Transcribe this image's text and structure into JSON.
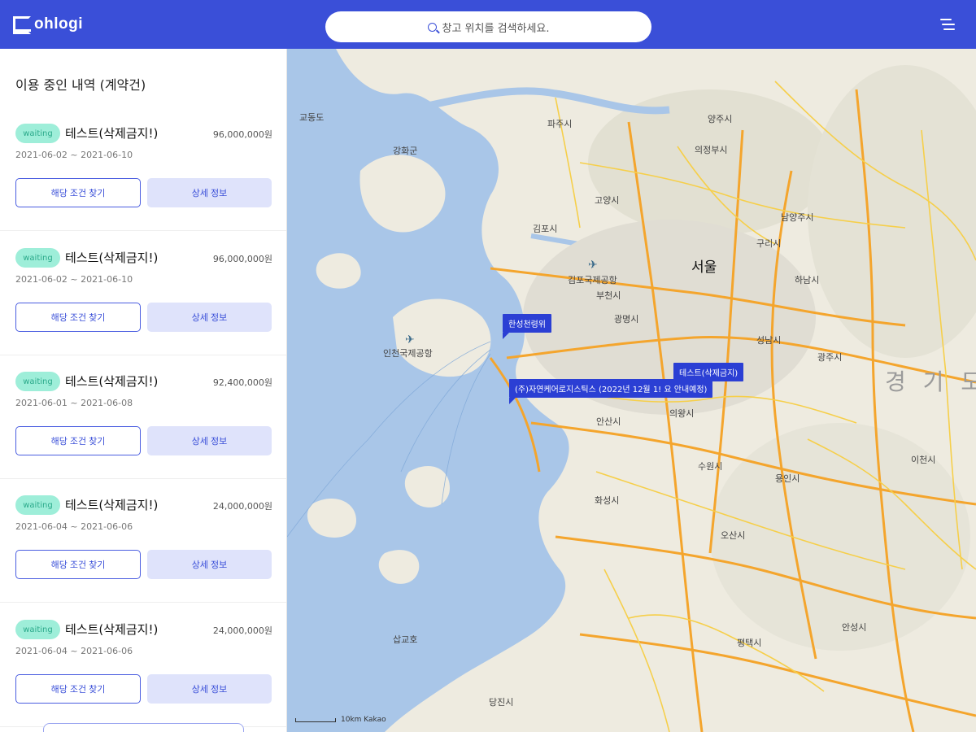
{
  "header": {
    "logo_text": "ohlogi",
    "search_placeholder": "창고 위치를 검색하세요."
  },
  "sidebar": {
    "title": "이용 중인 내역 (계약건)",
    "cards": [
      {
        "status": "waiting",
        "title": "테스트(삭제금지!)",
        "price": "96,000,000원",
        "dates": "2021-06-02 ~ 2021-06-10",
        "btn_find": "해당 조건 찾기",
        "btn_detail": "상세 정보"
      },
      {
        "status": "waiting",
        "title": "테스트(삭제금지!)",
        "price": "96,000,000원",
        "dates": "2021-06-02 ~ 2021-06-10",
        "btn_find": "해당 조건 찾기",
        "btn_detail": "상세 정보"
      },
      {
        "status": "waiting",
        "title": "테스트(삭제금지!)",
        "price": "92,400,000원",
        "dates": "2021-06-01 ~ 2021-06-08",
        "btn_find": "해당 조건 찾기",
        "btn_detail": "상세 정보"
      },
      {
        "status": "waiting",
        "title": "테스트(삭제금지!)",
        "price": "24,000,000원",
        "dates": "2021-06-04 ~ 2021-06-06",
        "btn_find": "해당 조건 찾기",
        "btn_detail": "상세 정보"
      },
      {
        "status": "waiting",
        "title": "테스트(삭제금지!)",
        "price": "24,000,000원",
        "dates": "2021-06-04 ~ 2021-06-06",
        "btn_find": "해당 조건 찾기",
        "btn_detail": "상세 정보"
      }
    ]
  },
  "map": {
    "markers": [
      {
        "label": "한성천령위"
      },
      {
        "label": "테스트(삭제금지)"
      },
      {
        "label": "(주)자연케어로지스틱스 (2022년 12월 1! 요 안내예정)"
      }
    ],
    "places": [
      {
        "name": "서울",
        "size": "big"
      },
      {
        "name": "경 기 도",
        "size": "huge"
      },
      {
        "name": "김포시"
      },
      {
        "name": "고양시"
      },
      {
        "name": "파주시"
      },
      {
        "name": "양주시"
      },
      {
        "name": "의정부시"
      },
      {
        "name": "남양주시"
      },
      {
        "name": "구리시"
      },
      {
        "name": "하남시"
      },
      {
        "name": "광명시"
      },
      {
        "name": "부천시"
      },
      {
        "name": "성남시"
      },
      {
        "name": "광주시"
      },
      {
        "name": "안산시"
      },
      {
        "name": "의왕시"
      },
      {
        "name": "수원시"
      },
      {
        "name": "용인시"
      },
      {
        "name": "이천시"
      },
      {
        "name": "화성시"
      },
      {
        "name": "오산시"
      },
      {
        "name": "안성시"
      },
      {
        "name": "평택시"
      },
      {
        "name": "당진시"
      },
      {
        "name": "강화군"
      },
      {
        "name": "교동도"
      },
      {
        "name": "인천국제공항"
      },
      {
        "name": "김포국제공항"
      },
      {
        "name": "삽교호"
      }
    ],
    "scale_label": "10km  Kakao"
  }
}
